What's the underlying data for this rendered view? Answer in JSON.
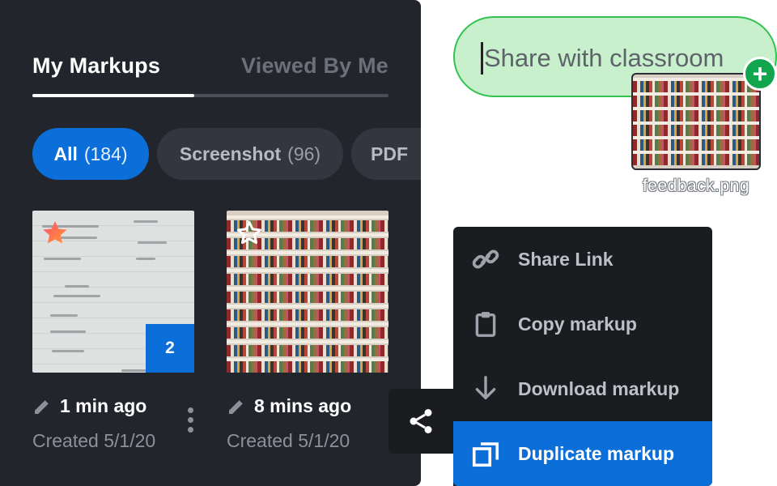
{
  "tabs": {
    "active": "My Markups",
    "inactive": "Viewed By Me"
  },
  "filters": [
    {
      "label": "All",
      "count": "(184)",
      "selected": true
    },
    {
      "label": "Screenshot",
      "count": "(96)",
      "selected": false
    },
    {
      "label": "PDF",
      "count": "",
      "selected": false
    }
  ],
  "cards": [
    {
      "edited": "1 min ago",
      "created": "Created 5/1/20",
      "badge": "2",
      "favorite": true,
      "thumb": "handwritten-notes"
    },
    {
      "edited": "8 mins ago",
      "created": "Created 5/1/20",
      "badge": "",
      "favorite": false,
      "thumb": "bookshelf"
    }
  ],
  "share_target": {
    "text": "Share with classroom",
    "add_icon": "plus-icon"
  },
  "dragged_file": {
    "name": "feedback.png"
  },
  "share_menu": [
    {
      "label": "Share Link",
      "icon": "link-icon"
    },
    {
      "label": "Copy markup",
      "icon": "clipboard-icon"
    },
    {
      "label": "Download markup",
      "icon": "download-icon"
    },
    {
      "label": "Duplicate markup",
      "icon": "duplicate-icon",
      "highlighted": true
    }
  ],
  "colors": {
    "accent": "#0c6fd9",
    "panel": "#22252c",
    "menu": "#1a1c20",
    "success": "#11a64e",
    "drop_zone": "#c8f0cc"
  }
}
